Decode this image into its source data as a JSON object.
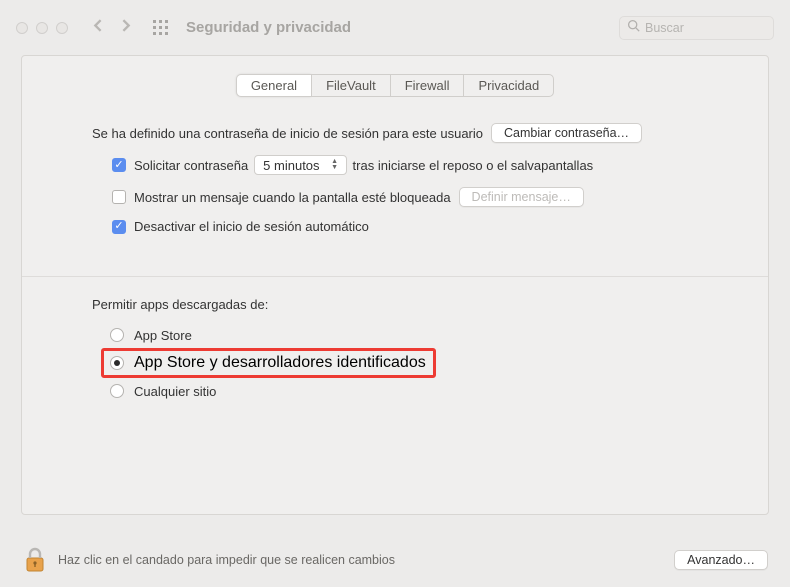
{
  "window": {
    "title": "Seguridad y privacidad",
    "search_placeholder": "Buscar"
  },
  "tabs": {
    "general": "General",
    "filevault": "FileVault",
    "firewall": "Firewall",
    "privacy": "Privacidad"
  },
  "general": {
    "password_defined": "Se ha definido una contraseña de inicio de sesión para este usuario",
    "change_password": "Cambiar contraseña…",
    "require_password": "Solicitar contraseña",
    "grace_value": "5 minutos",
    "grace_suffix": "tras iniciarse el reposo o el salvapantallas",
    "show_message": "Mostrar un mensaje cuando la pantalla esté bloqueada",
    "set_message": "Definir mensaje…",
    "disable_auto_login": "Desactivar el inicio de sesión automático"
  },
  "gatekeeper": {
    "label": "Permitir apps descargadas de:",
    "opt_appstore": "App Store",
    "opt_identified": "App Store y desarrolladores identificados",
    "opt_anywhere": "Cualquier sitio"
  },
  "footer": {
    "lock_text": "Haz clic en el candado para impedir que se realicen cambios",
    "advanced": "Avanzado…"
  }
}
